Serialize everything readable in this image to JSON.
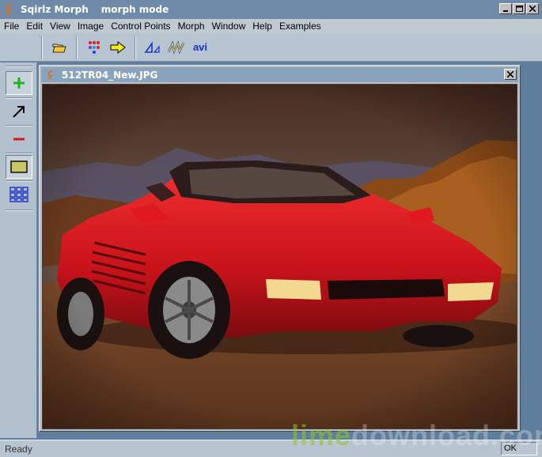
{
  "window": {
    "app_title": "Sqirlz Morph",
    "mode": "morph mode"
  },
  "menu": [
    "File",
    "Edit",
    "View",
    "Image",
    "Control Points",
    "Morph",
    "Window",
    "Help",
    "Examples"
  ],
  "toolbar": {
    "open_icon": "folder-open-icon",
    "points_icon": "colored-dots-icon",
    "next_icon": "yellow-arrow-icon",
    "triangle_icon": "triangle-delta-icon",
    "wave_icon": "yellow-zigzag-icon",
    "avi_label": "avi"
  },
  "palette": {
    "add_point_icon": "plus-icon",
    "select_icon": "arrow-icon",
    "remove_point_icon": "minus-icon",
    "rectangle_icon": "rectangle-icon",
    "grid_icon": "grid-icon"
  },
  "image_window": {
    "title": "512TR04_New.JPG"
  },
  "status": {
    "text": "Ready",
    "indicator": "OK"
  },
  "watermark": {
    "part1": "lime",
    "part2": "download.com"
  },
  "colors": {
    "accent_blue": "#1a32c8",
    "car_red": "#d8141a",
    "plus_green": "#22b422",
    "minus_red": "#d41c1c"
  }
}
